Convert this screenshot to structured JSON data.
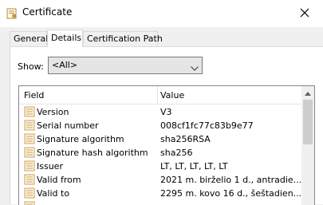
{
  "window": {
    "title": "Certificate",
    "close_icon": "close-icon",
    "title_icon": "certificate-icon"
  },
  "tabs": [
    {
      "label": "General",
      "active": false
    },
    {
      "label": "Details",
      "active": true
    },
    {
      "label": "Certification Path",
      "active": false
    }
  ],
  "show": {
    "label": "Show:",
    "selected": "<All>"
  },
  "list": {
    "columns": {
      "field": "Field",
      "value": "Value"
    },
    "rows": [
      {
        "field": "Version",
        "value": "V3",
        "icon": "certificate-field-icon"
      },
      {
        "field": "Serial number",
        "value": "008cf1fc77c83b9e77",
        "icon": "certificate-field-icon"
      },
      {
        "field": "Signature algorithm",
        "value": "sha256RSA",
        "icon": "certificate-field-icon"
      },
      {
        "field": "Signature hash algorithm",
        "value": "sha256",
        "icon": "certificate-field-icon"
      },
      {
        "field": "Issuer",
        "value": "LT, LT, LT, LT, LT",
        "icon": "certificate-field-icon"
      },
      {
        "field": "Valid from",
        "value": "2021 m. birželio 1 d., antradie...",
        "icon": "certificate-field-icon"
      },
      {
        "field": "Valid to",
        "value": "2295 m. kovo 16 d., šeštadien...",
        "icon": "certificate-field-icon"
      }
    ]
  },
  "colors": {
    "accent_icon": "#c8a060",
    "panel_bg": "#ffffff",
    "window_bg": "#f0f0f0"
  }
}
